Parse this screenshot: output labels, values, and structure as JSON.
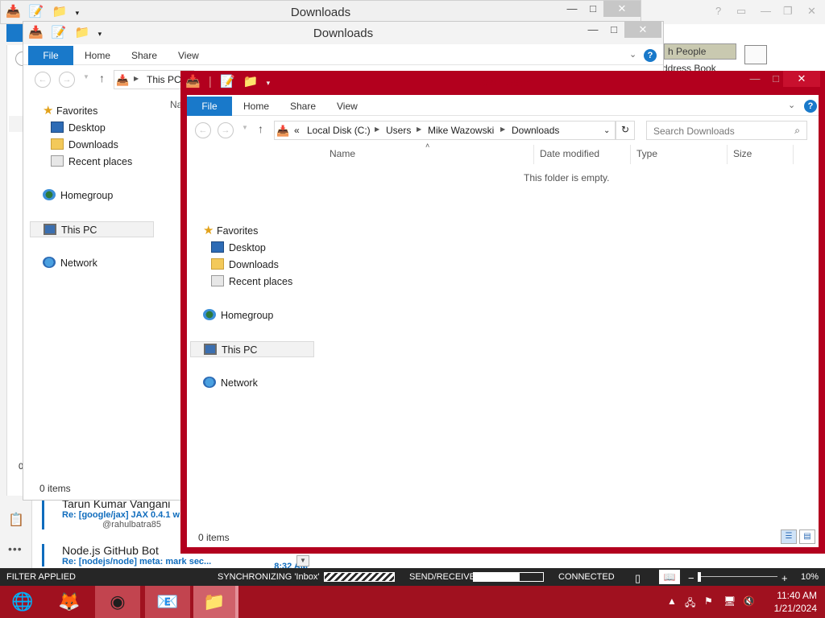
{
  "outlook": {
    "ribbon": {
      "find_people": "h People",
      "address_book": "ddress Book"
    },
    "mail_items": [
      {
        "sender": "Tarun Kumar Vangani",
        "subject": "Re: [google/jax] JAX 0.4.1 w",
        "handle": "@rahulbatra85"
      },
      {
        "sender": "Node.js GitHub Bot",
        "subject": "Re: [nodejs/node] meta: mark sec...",
        "time": "8:32 AM"
      }
    ],
    "status": {
      "filter": "FILTER APPLIED",
      "sync": "SYNCHRONIZING 'Inbox'",
      "send_receive": "SEND/RECEIVE",
      "connected": "CONNECTED",
      "zoom": "10%",
      "sync_progress": 0.5,
      "send_receive_progress": 0.66
    }
  },
  "back_window": {
    "title": "Downloads",
    "status": "0 items"
  },
  "middle_window": {
    "title": "Downloads",
    "tabs": [
      "File",
      "Home",
      "Share",
      "View"
    ],
    "address": "This PC",
    "nav": {
      "favorites": "Favorites",
      "desktop": "Desktop",
      "downloads": "Downloads",
      "recent": "Recent places",
      "homegroup": "Homegroup",
      "this_pc": "This PC",
      "network": "Network"
    },
    "status": "0 items"
  },
  "front_window": {
    "title": "Downloads",
    "tabs": [
      "File",
      "Home",
      "Share",
      "View"
    ],
    "breadcrumb": [
      "Local Disk (C:)",
      "Users",
      "Mike Wazowski",
      "Downloads"
    ],
    "breadcrumb_prefix": "«",
    "search_placeholder": "Search Downloads",
    "columns": [
      "Name",
      "Date modified",
      "Type",
      "Size"
    ],
    "empty_message": "This folder is empty.",
    "nav": {
      "favorites": "Favorites",
      "desktop": "Desktop",
      "downloads": "Downloads",
      "recent": "Recent places",
      "homegroup": "Homegroup",
      "this_pc": "This PC",
      "network": "Network"
    },
    "status": "0 items"
  },
  "taskbar": {
    "apps": [
      "start-globe",
      "firefox",
      "chrome",
      "outlook",
      "file-explorer"
    ],
    "time": "11:40 AM",
    "date": "1/21/2024",
    "accent": "#a0111f"
  }
}
